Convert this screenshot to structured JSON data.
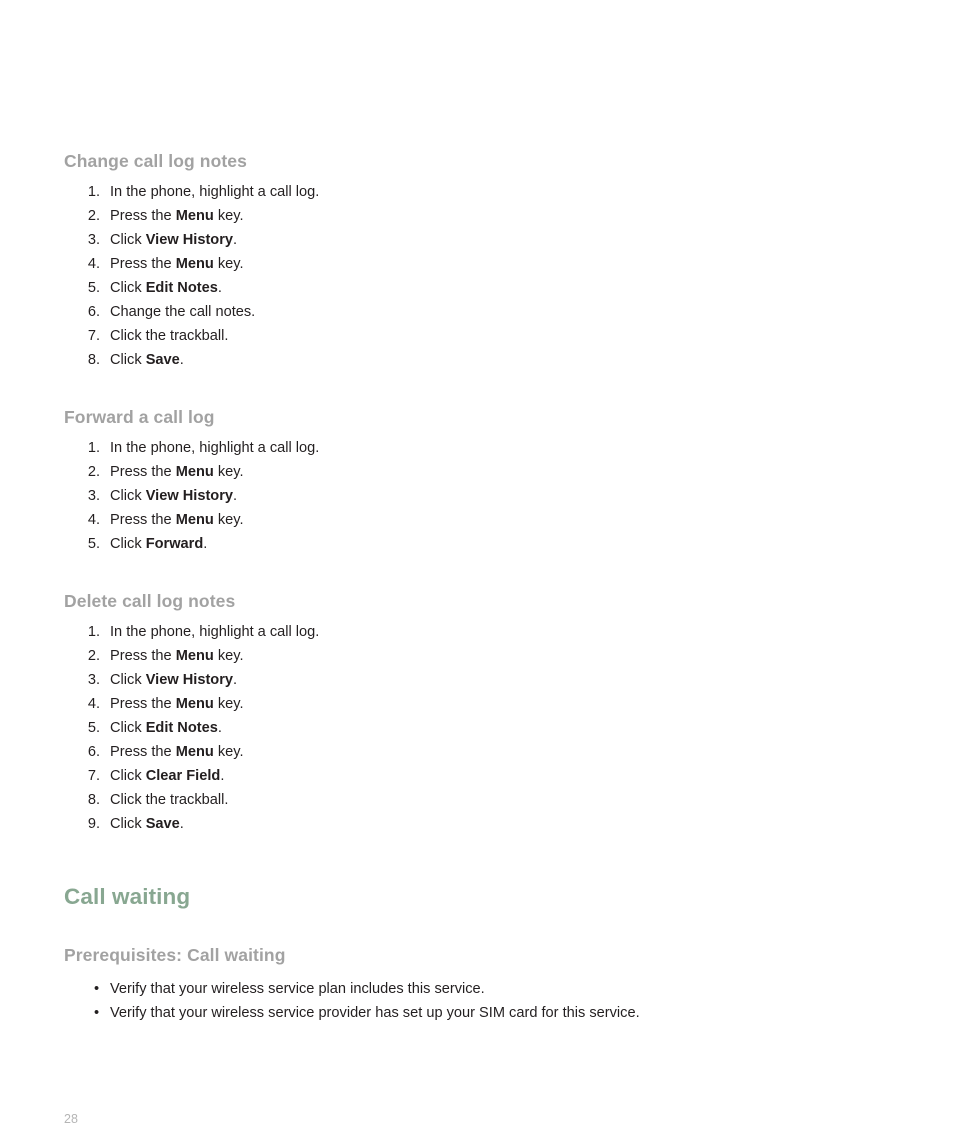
{
  "colors": {
    "chapter_heading": "#88a791",
    "section_heading": "#a2a2a2",
    "body_text": "#231f20",
    "page_number": "#b5b5b5",
    "background": "#ffffff"
  },
  "sections": [
    {
      "heading": "Change call log notes",
      "type": "ordered",
      "items": [
        {
          "num": "1.",
          "parts": [
            {
              "t": "In the phone, highlight a call log.",
              "b": false
            }
          ]
        },
        {
          "num": "2.",
          "parts": [
            {
              "t": "Press the ",
              "b": false
            },
            {
              "t": "Menu",
              "b": true
            },
            {
              "t": " key.",
              "b": false
            }
          ]
        },
        {
          "num": "3.",
          "parts": [
            {
              "t": "Click ",
              "b": false
            },
            {
              "t": "View History",
              "b": true
            },
            {
              "t": ".",
              "b": false
            }
          ]
        },
        {
          "num": "4.",
          "parts": [
            {
              "t": "Press the ",
              "b": false
            },
            {
              "t": "Menu",
              "b": true
            },
            {
              "t": " key.",
              "b": false
            }
          ]
        },
        {
          "num": "5.",
          "parts": [
            {
              "t": "Click ",
              "b": false
            },
            {
              "t": "Edit Notes",
              "b": true
            },
            {
              "t": ".",
              "b": false
            }
          ]
        },
        {
          "num": "6.",
          "parts": [
            {
              "t": "Change the call notes.",
              "b": false
            }
          ]
        },
        {
          "num": "7.",
          "parts": [
            {
              "t": "Click the trackball.",
              "b": false
            }
          ]
        },
        {
          "num": "8.",
          "parts": [
            {
              "t": "Click ",
              "b": false
            },
            {
              "t": "Save",
              "b": true
            },
            {
              "t": ".",
              "b": false
            }
          ]
        }
      ]
    },
    {
      "heading": "Forward a call log",
      "type": "ordered",
      "items": [
        {
          "num": "1.",
          "parts": [
            {
              "t": "In the phone, highlight a call log.",
              "b": false
            }
          ]
        },
        {
          "num": "2.",
          "parts": [
            {
              "t": "Press the ",
              "b": false
            },
            {
              "t": "Menu",
              "b": true
            },
            {
              "t": " key.",
              "b": false
            }
          ]
        },
        {
          "num": "3.",
          "parts": [
            {
              "t": "Click ",
              "b": false
            },
            {
              "t": "View History",
              "b": true
            },
            {
              "t": ".",
              "b": false
            }
          ]
        },
        {
          "num": "4.",
          "parts": [
            {
              "t": "Press the ",
              "b": false
            },
            {
              "t": "Menu",
              "b": true
            },
            {
              "t": " key.",
              "b": false
            }
          ]
        },
        {
          "num": "5.",
          "parts": [
            {
              "t": "Click ",
              "b": false
            },
            {
              "t": "Forward",
              "b": true
            },
            {
              "t": ".",
              "b": false
            }
          ]
        }
      ]
    },
    {
      "heading": "Delete call log notes",
      "type": "ordered",
      "items": [
        {
          "num": "1.",
          "parts": [
            {
              "t": "In the phone, highlight a call log.",
              "b": false
            }
          ]
        },
        {
          "num": "2.",
          "parts": [
            {
              "t": "Press the ",
              "b": false
            },
            {
              "t": "Menu",
              "b": true
            },
            {
              "t": " key.",
              "b": false
            }
          ]
        },
        {
          "num": "3.",
          "parts": [
            {
              "t": "Click ",
              "b": false
            },
            {
              "t": "View History",
              "b": true
            },
            {
              "t": ".",
              "b": false
            }
          ]
        },
        {
          "num": "4.",
          "parts": [
            {
              "t": "Press the ",
              "b": false
            },
            {
              "t": "Menu",
              "b": true
            },
            {
              "t": " key.",
              "b": false
            }
          ]
        },
        {
          "num": "5.",
          "parts": [
            {
              "t": "Click ",
              "b": false
            },
            {
              "t": "Edit Notes",
              "b": true
            },
            {
              "t": ".",
              "b": false
            }
          ]
        },
        {
          "num": "6.",
          "parts": [
            {
              "t": "Press the ",
              "b": false
            },
            {
              "t": "Menu",
              "b": true
            },
            {
              "t": " key.",
              "b": false
            }
          ]
        },
        {
          "num": "7.",
          "parts": [
            {
              "t": "Click ",
              "b": false
            },
            {
              "t": "Clear Field",
              "b": true
            },
            {
              "t": ".",
              "b": false
            }
          ]
        },
        {
          "num": "8.",
          "parts": [
            {
              "t": "Click the trackball.",
              "b": false
            }
          ]
        },
        {
          "num": "9.",
          "parts": [
            {
              "t": "Click ",
              "b": false
            },
            {
              "t": "Save",
              "b": true
            },
            {
              "t": ".",
              "b": false
            }
          ]
        }
      ]
    }
  ],
  "chapter": {
    "heading": "Call waiting"
  },
  "prerequisites": {
    "heading": "Prerequisites: Call waiting",
    "type": "bullets",
    "bullet_glyph": "•",
    "items": [
      {
        "parts": [
          {
            "t": "Verify that your wireless service plan includes this service.",
            "b": false
          }
        ]
      },
      {
        "parts": [
          {
            "t": "Verify that your wireless service provider has set up your SIM card for this service.",
            "b": false
          }
        ]
      }
    ]
  },
  "footer": {
    "page_number": "28"
  }
}
